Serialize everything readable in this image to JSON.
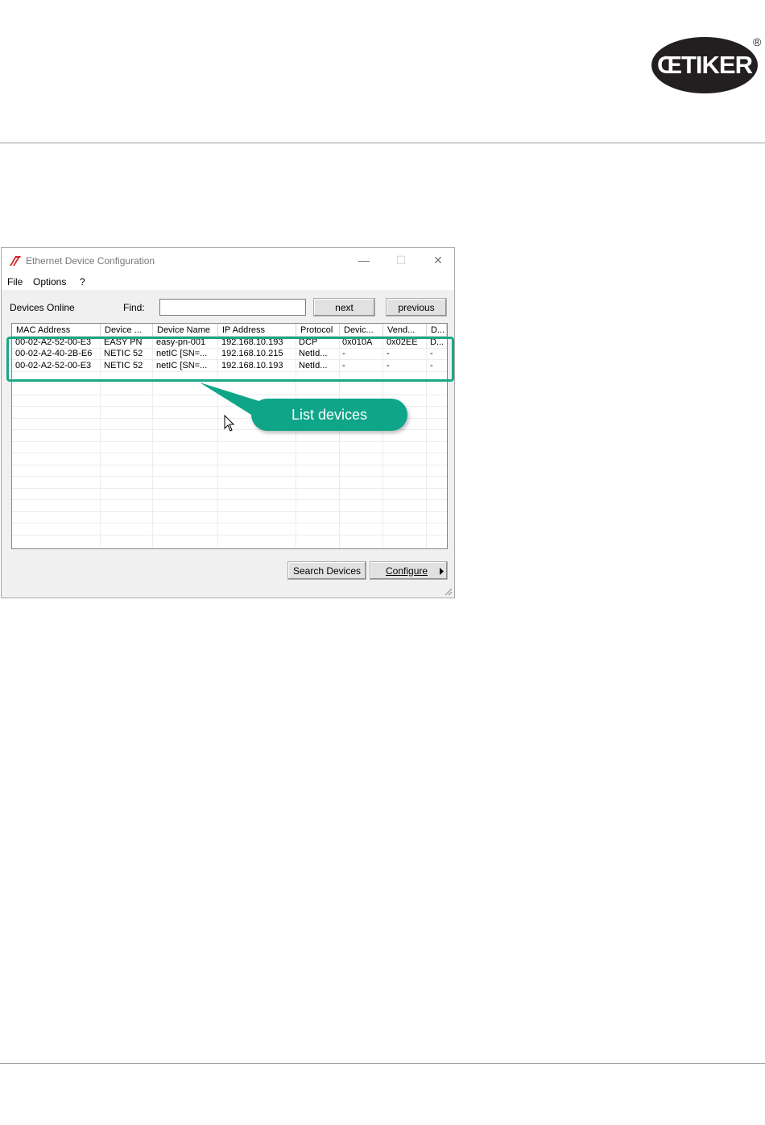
{
  "brand": {
    "name": "ŒTIKER",
    "registered": "®"
  },
  "window": {
    "title": "Ethernet Device Configuration",
    "controls": {
      "minimize": "—",
      "maximize": "☐",
      "close": "✕"
    },
    "menu": [
      "File",
      "Options",
      "?"
    ],
    "devices_online_label": "Devices Online",
    "find_label": "Find:",
    "find_value": "",
    "next_label": "next",
    "previous_label": "previous",
    "columns": [
      "MAC Address",
      "Device ...",
      "Device Name",
      "IP Address",
      "Protocol",
      "Devic...",
      "Vend...",
      "D..."
    ],
    "rows": [
      [
        "00-02-A2-52-00-E3",
        "EASY PN",
        "easy-pn-001",
        "192.168.10.193",
        "DCP",
        "0x010A",
        "0x02EE",
        "D..."
      ],
      [
        "00-02-A2-40-2B-E6",
        "NETIC 52",
        "netIC [SN=...",
        "192.168.10.215",
        "NetId...",
        "-",
        "-",
        "-"
      ],
      [
        "00-02-A2-52-00-E3",
        "NETIC 52",
        "netIC [SN=...",
        "192.168.10.193",
        "NetId...",
        "-",
        "-",
        "-"
      ]
    ],
    "search_devices_label": "Search Devices",
    "configure_label": "Configure"
  },
  "callout": {
    "text": "List devices"
  },
  "colors": {
    "accent": "#1aa887",
    "brand": "#231f20"
  }
}
